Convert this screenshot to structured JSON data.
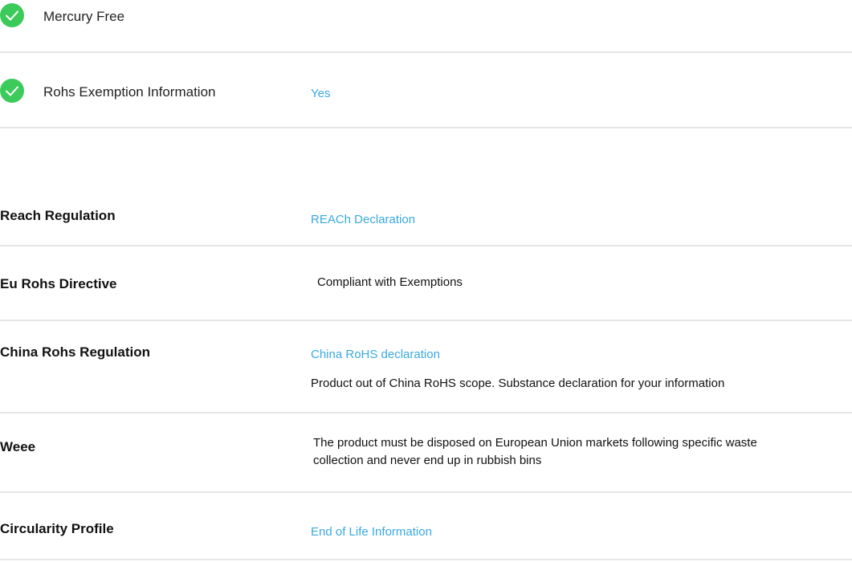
{
  "environmental": {
    "mercury_free": {
      "label": "Mercury Free"
    },
    "rohs_exemption": {
      "label": "Rohs Exemption Information",
      "value": "Yes"
    }
  },
  "regulations": {
    "reach": {
      "label": "Reach Regulation",
      "link": "REACh Declaration"
    },
    "eu_rohs": {
      "label": "Eu Rohs Directive",
      "value": "Compliant with Exemptions"
    },
    "china_rohs": {
      "label": "China Rohs Regulation",
      "link": "China RoHS declaration",
      "note": "Product out of China RoHS scope. Substance declaration for your information"
    },
    "weee": {
      "label": "Weee",
      "value": "The product must be disposed on European Union markets following specific waste collection and never end up in rubbish bins"
    },
    "circularity": {
      "label": "Circularity Profile",
      "link": "End of Life Information"
    }
  },
  "colors": {
    "check_green": "#3ccb5a",
    "link_blue": "#3aa9e0",
    "divider": "#e6e6e6"
  },
  "icons": {
    "check": "check-circle-icon"
  }
}
